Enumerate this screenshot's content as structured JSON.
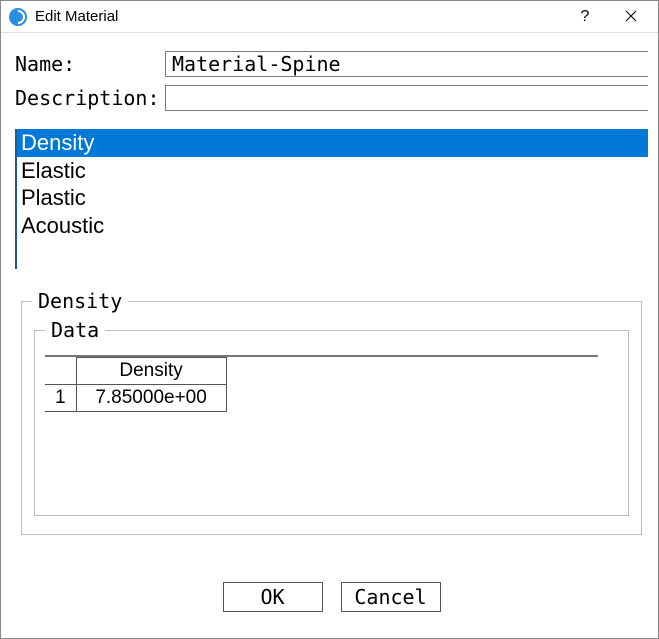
{
  "window": {
    "title": "Edit Material",
    "help": "?"
  },
  "form": {
    "name_label": "Name:",
    "name_value": "Material-Spine",
    "desc_label": "Description:",
    "desc_value": ""
  },
  "properties": {
    "items": [
      {
        "label": "Density",
        "selected": true
      },
      {
        "label": "Elastic",
        "selected": false
      },
      {
        "label": "Plastic",
        "selected": false
      },
      {
        "label": "Acoustic",
        "selected": false
      }
    ]
  },
  "detail": {
    "group_title": "Density",
    "data_title": "Data",
    "table": {
      "column_header": "Density",
      "rows": [
        {
          "index": "1",
          "value": "7.85000e+00"
        }
      ]
    }
  },
  "buttons": {
    "ok": "OK",
    "cancel": "Cancel"
  }
}
